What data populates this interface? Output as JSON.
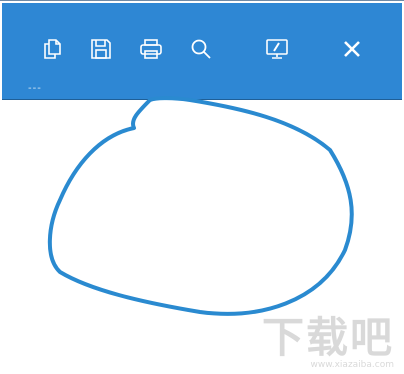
{
  "toolbar": {
    "background": "#2e87d4",
    "icons": {
      "copy": "copy-icon",
      "save": "save-icon",
      "print": "print-icon",
      "search": "search-icon",
      "screen": "screen-pen-icon",
      "close": "close-icon"
    },
    "status_text": "---"
  },
  "drawing": {
    "stroke_color": "#2a8ad0",
    "shape": "hand-drawn closed loop"
  },
  "watermark": {
    "main": "下载吧",
    "url": "www.xiazaiba.com"
  }
}
